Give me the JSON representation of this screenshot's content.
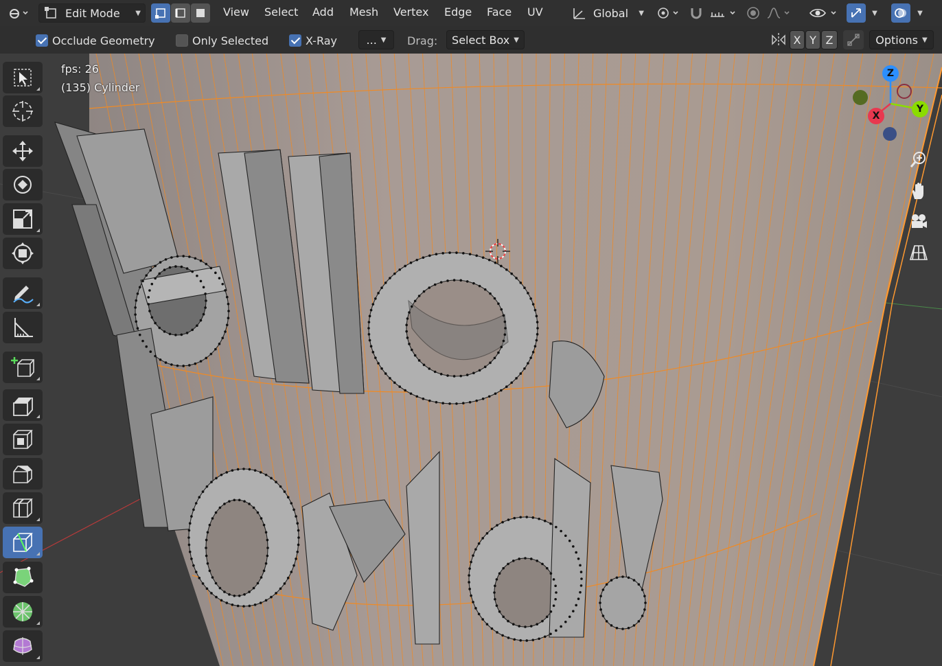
{
  "header": {
    "mode_label": "Edit Mode",
    "menus": [
      "View",
      "Select",
      "Add",
      "Mesh",
      "Vertex",
      "Edge",
      "Face",
      "UV"
    ],
    "transform_orientation": "Global"
  },
  "tool_settings": {
    "occlude_geometry": {
      "label": "Occlude Geometry",
      "checked": true
    },
    "only_selected": {
      "label": "Only Selected",
      "checked": false
    },
    "xray": {
      "label": "X-Ray",
      "checked": true
    },
    "more_label": "...",
    "drag_label": "Drag:",
    "drag_value": "Select Box",
    "mirror_axes": [
      "X",
      "Y",
      "Z"
    ],
    "options_label": "Options"
  },
  "viewport": {
    "fps_text": "fps: 26",
    "object_text": "(135) Cylinder",
    "gizmo": {
      "x": "X",
      "y": "Y",
      "z": "Z"
    }
  },
  "colors": {
    "accent": "#4772b3",
    "selection_orange": "#f08a24",
    "axis_x": "#e8384f",
    "axis_y": "#8bdc00",
    "axis_z": "#2c8fff"
  },
  "tools": [
    {
      "name": "select-box-tool",
      "icon": "select-cursor-icon",
      "active": false
    },
    {
      "name": "cursor-tool",
      "icon": "crosshair-icon",
      "active": false
    },
    {
      "name": "move-tool",
      "icon": "move-arrows-icon",
      "active": false
    },
    {
      "name": "rotate-tool",
      "icon": "rotate-icon",
      "active": false
    },
    {
      "name": "scale-tool",
      "icon": "scale-icon",
      "active": false
    },
    {
      "name": "transform-tool",
      "icon": "transform-icon",
      "active": false
    },
    {
      "name": "annotate-tool",
      "icon": "pen-icon",
      "active": false
    },
    {
      "name": "measure-tool",
      "icon": "ruler-icon",
      "active": false
    },
    {
      "name": "add-cube-tool",
      "icon": "add-cube-icon",
      "active": false
    },
    {
      "name": "extrude-tool",
      "icon": "extrude-icon",
      "active": false
    },
    {
      "name": "inset-tool",
      "icon": "inset-icon",
      "active": false
    },
    {
      "name": "bevel-tool",
      "icon": "bevel-icon",
      "active": false
    },
    {
      "name": "loop-cut-tool",
      "icon": "loop-cut-icon",
      "active": false
    },
    {
      "name": "knife-tool",
      "icon": "knife-icon",
      "active": true
    },
    {
      "name": "poly-build-tool",
      "icon": "poly-build-icon",
      "active": false
    },
    {
      "name": "spin-tool",
      "icon": "spin-icon",
      "active": false
    },
    {
      "name": "smooth-tool",
      "icon": "smooth-icon",
      "active": false
    }
  ]
}
